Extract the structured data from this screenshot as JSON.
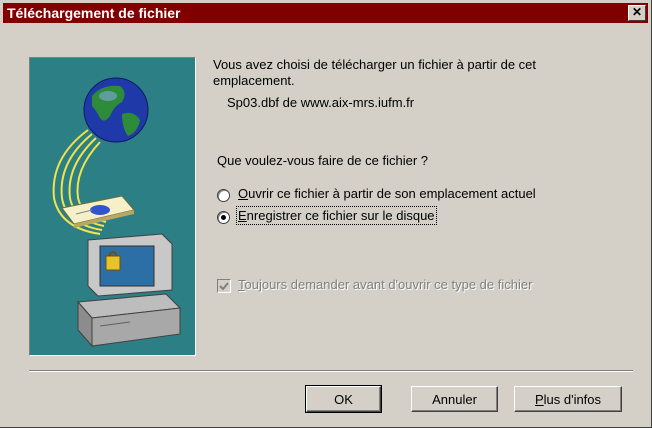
{
  "dialog": {
    "title": "Téléchargement de fichier",
    "close_label": "✕",
    "intro_line1": "Vous avez choisi de télécharger un fichier à partir de cet",
    "intro_line2": "emplacement.",
    "file_info": "Sp03.dbf de www.aix-mrs.iufm.fr",
    "question": "Que voulez-vous faire de ce fichier ?",
    "option_open_prefix": "O",
    "option_open_rest": "uvrir ce fichier à partir de son emplacement actuel",
    "option_save_prefix": "E",
    "option_save_rest": "nregistrer ce fichier sur le disque",
    "selected_option": "save",
    "always_ask_prefix": "T",
    "always_ask_rest": "oujours demander avant d'ouvrir ce type de fichier",
    "always_ask_checked": true,
    "always_ask_enabled": false
  },
  "buttons": {
    "ok": "OK",
    "cancel": "Annuler",
    "more_prefix": "P",
    "more_rest": "lus d'infos"
  },
  "icons": {
    "illustration": "globe-download-computer-icon"
  },
  "colors": {
    "titlebar": "#800000",
    "illustration_bg": "#2d7f86",
    "face": "#d4d0c8"
  }
}
